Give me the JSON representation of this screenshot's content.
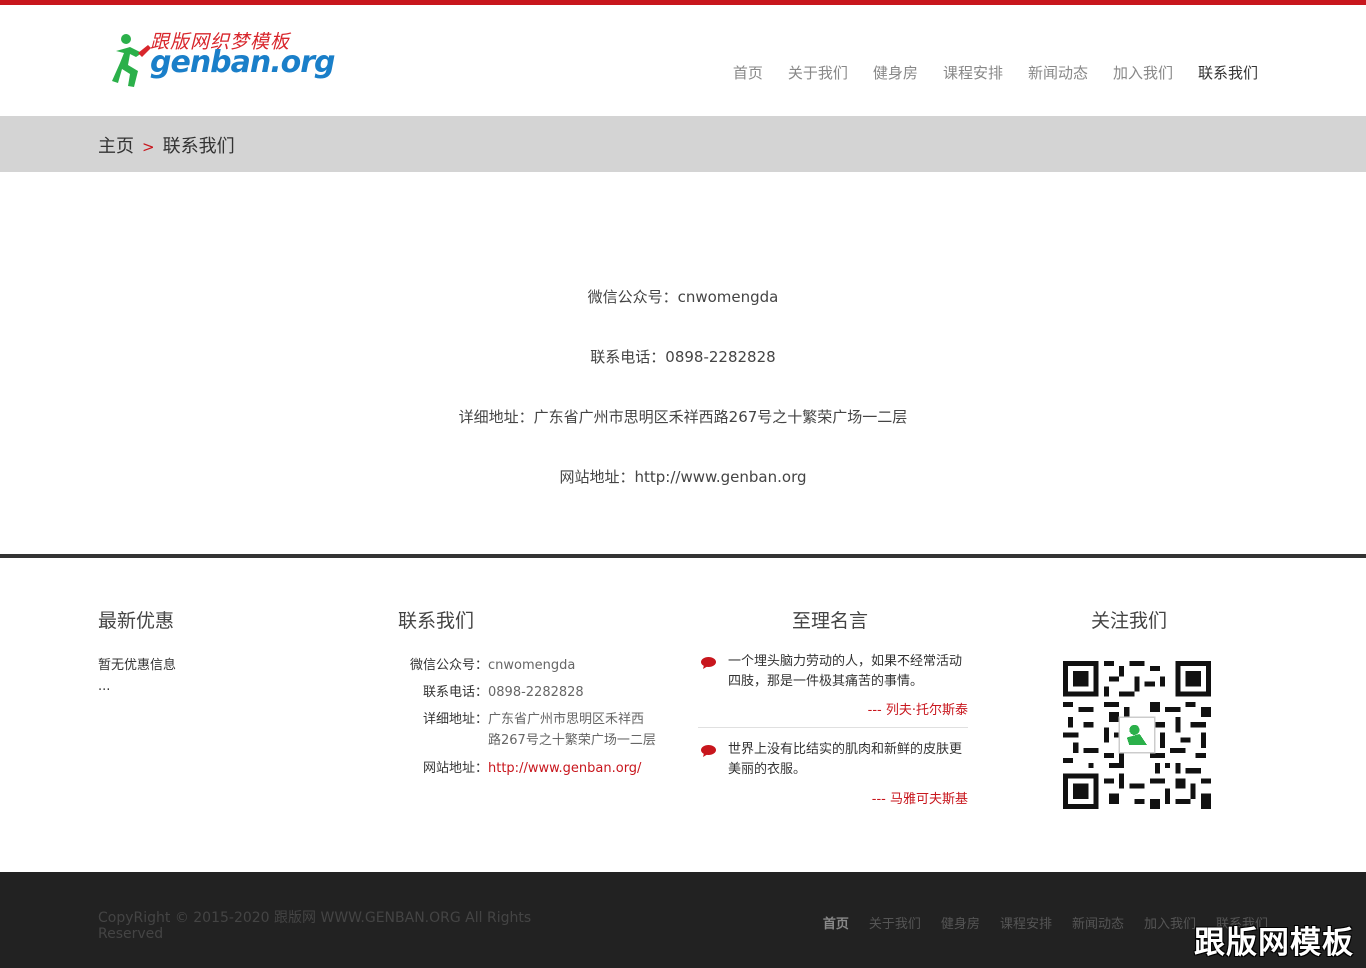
{
  "brand": {
    "logo_cn": "跟版网织梦模板",
    "logo_en": "genban.org",
    "accent": "#c8161d",
    "logo_blue": "#1a7fc9",
    "logo_green": "#2bb04a"
  },
  "nav": {
    "items": [
      {
        "label": "首页"
      },
      {
        "label": "关于我们"
      },
      {
        "label": "健身房"
      },
      {
        "label": "课程安排"
      },
      {
        "label": "新闻动态"
      },
      {
        "label": "加入我们"
      },
      {
        "label": "联系我们"
      }
    ]
  },
  "breadcrumb": {
    "home": "主页",
    "separator": ">",
    "current": "联系我们"
  },
  "contact_main": {
    "wechat": "微信公众号：cnwomengda",
    "phone": "联系电话：0898-2282828",
    "address": "详细地址：广东省广州市思明区禾祥西路267号之十繁荣广场一二层",
    "website": "网站地址：http://www.genban.org"
  },
  "footer_widgets": {
    "offers": {
      "title": "最新优惠",
      "text": "暂无优惠信息",
      "more": "..."
    },
    "contact": {
      "title": "联系我们",
      "wechat_label": "微信公众号：",
      "wechat_value": "cnwomengda",
      "phone_label": "联系电话：",
      "phone_value": "0898-2282828",
      "address_label": "详细地址：",
      "address_line1": "广东省广州市思明区禾祥西",
      "address_line2": "路267号之十繁荣广场一二层",
      "website_label": "网站地址：",
      "website_value": "http://www.genban.org/"
    },
    "quotes": {
      "title": "至理名言",
      "items": [
        {
          "text": "一个埋头脑力劳动的人，如果不经常活动四肢，那是一件极其痛苦的事情。",
          "author": "--- 列夫·托尔斯泰",
          "icon": "speech-bubble-icon"
        },
        {
          "text": "世界上没有比结实的肌肉和新鲜的皮肤更美丽的衣服。",
          "author": "--- 马雅可夫斯基",
          "icon": "speech-bubble-icon"
        }
      ]
    },
    "follow": {
      "title": "关注我们",
      "qr_icon": "qr-code-icon"
    }
  },
  "bottom": {
    "copyright": "CopyRight © 2015-2020 跟版网 WWW.GENBAN.ORG All Rights Reserved",
    "nav": [
      {
        "label": "首页"
      },
      {
        "label": "关于我们"
      },
      {
        "label": "健身房"
      },
      {
        "label": "课程安排"
      },
      {
        "label": "新闻动态"
      },
      {
        "label": "加入我们"
      },
      {
        "label": "联系我们"
      }
    ],
    "watermark": "跟版网模板"
  }
}
